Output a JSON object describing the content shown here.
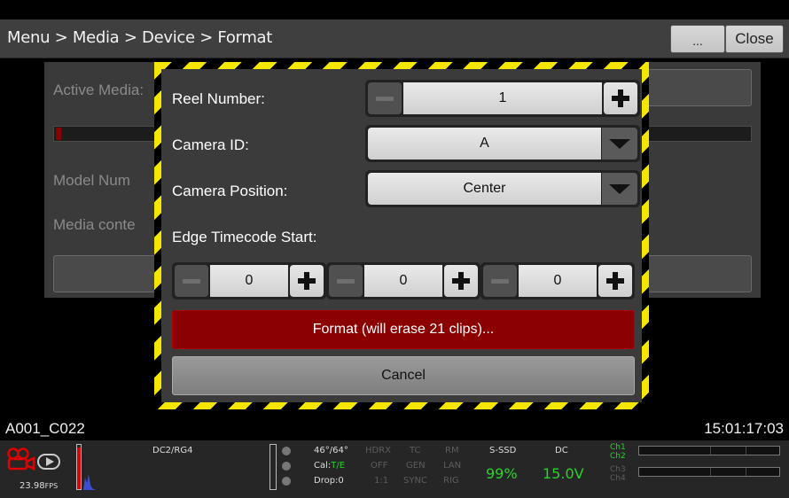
{
  "header": {
    "breadcrumb": "Menu > Media > Device > Format",
    "more_label": "...",
    "close_label": "Close"
  },
  "background": {
    "active_media_label": "Active Media:",
    "model_number_label": "Model Num",
    "media_contents_label": "Media conte"
  },
  "dialog": {
    "reel_number_label": "Reel Number:",
    "reel_number_value": "1",
    "camera_id_label": "Camera ID:",
    "camera_id_value": "A",
    "camera_position_label": "Camera Position:",
    "camera_position_value": "Center",
    "edge_timecode_label": "Edge Timecode Start:",
    "timecode_fields": [
      "0",
      "0",
      "0"
    ],
    "format_label": "Format (will erase 21 clips)...",
    "cancel_label": "Cancel"
  },
  "status": {
    "clip_name": "A001_C022",
    "timecode": "15:01:17:03"
  },
  "statusbar": {
    "fps": "23.98",
    "fps_unit": "FPS",
    "color_space": "DC2/RG4",
    "temps": "46°/64°",
    "cal_prefix": "Cal:",
    "cal_value": "T/E",
    "drop": "Drop:0",
    "hdrx": "HDRX",
    "hdrx_state": "OFF",
    "hdrx_ratio": "1:1",
    "tc": "TC",
    "gen": "GEN",
    "sync": "SYNC",
    "rm": "RM",
    "lan": "LAN",
    "rig": "RIG",
    "media_type": "S-SSD",
    "media_percent": "99%",
    "power_type": "DC",
    "power_voltage": "15.0V",
    "channels": [
      "Ch1",
      "Ch2",
      "Ch3",
      "Ch4"
    ],
    "record_level": 0.95
  },
  "colors": {
    "accent_red": "#8b0000",
    "hazard_yellow": "#f5e600",
    "status_green": "#29d329"
  },
  "icons": {
    "camera": "camera-icon",
    "play": "play-mode-icon",
    "plus": "plus-icon",
    "minus": "minus-icon",
    "dropdown": "chevron-down-icon"
  }
}
